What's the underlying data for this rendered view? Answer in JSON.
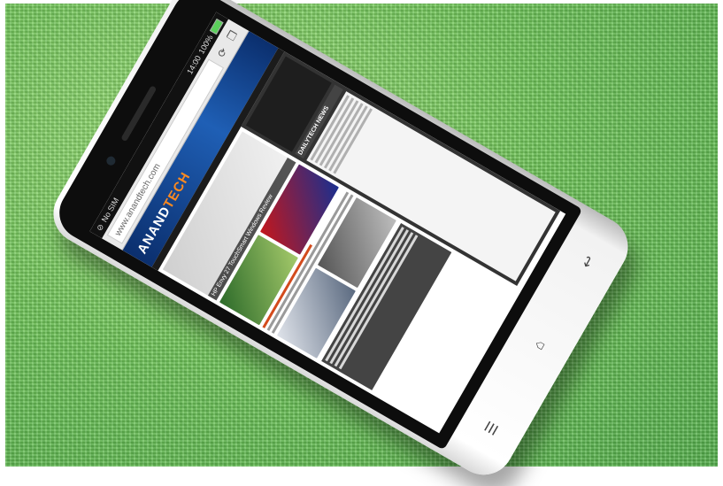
{
  "status_bar": {
    "carrier": "No SIM",
    "time": "14:00",
    "battery": "100%"
  },
  "browser": {
    "url": "www.anandtech.com"
  },
  "site": {
    "logo_main": "ANAND",
    "logo_accent": "TECH",
    "hero_caption": "HP Envy 27 TouchSmart Windows Review",
    "sidebar_title": "DAILYTECH NEWS"
  },
  "icons": {
    "menu": "menu-icon",
    "home": "home-icon",
    "back": "back-icon",
    "refresh": "refresh-icon",
    "tabs": "tabs-icon"
  },
  "colors": {
    "fabric": "#72c75a",
    "header": "#1f5fb5",
    "accent": "#ff8a1f"
  }
}
